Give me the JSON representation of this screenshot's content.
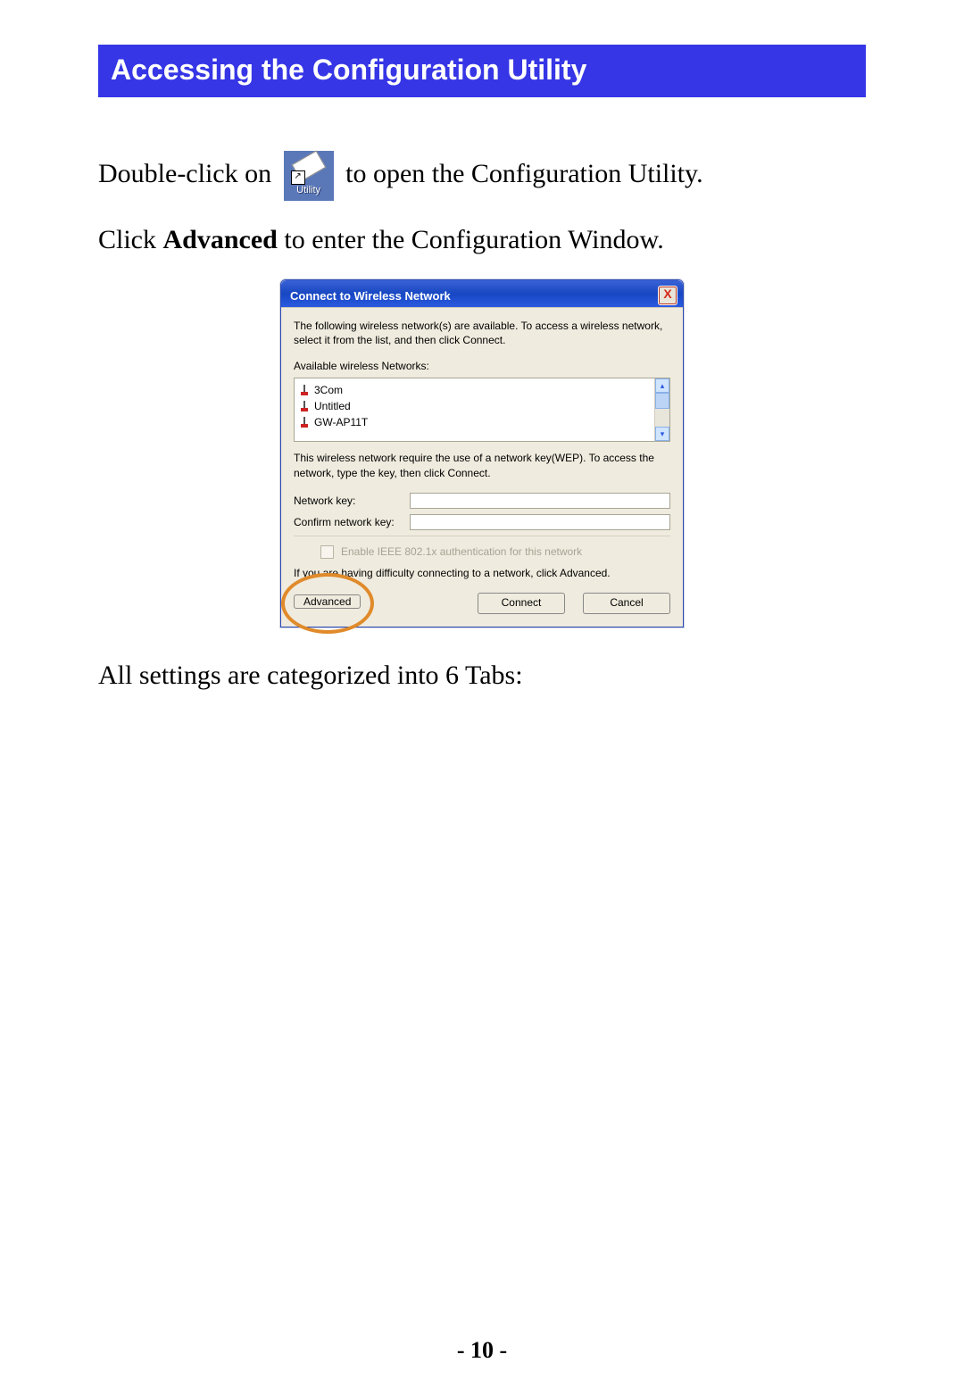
{
  "section_title": "Accessing the Configuration Utility",
  "para1_a": "Double-click on ",
  "para1_b": "to open the Configuration Utility.",
  "utility_icon_label": "Utility",
  "para2_a": "Click ",
  "para2_bold": "Advanced",
  "para2_b": " to enter the Configuration Window.",
  "dialog": {
    "title": "Connect to Wireless Network",
    "close": "X",
    "intro": "The following wireless network(s) are available. To access a wireless network, select it from the list, and then click Connect.",
    "available_label": "Available wireless Networks:",
    "networks": [
      "3Com",
      "Untitled",
      "GW-AP11T"
    ],
    "wep_text": "This wireless network require the use of a network key(WEP). To access the network, type the key, then click Connect.",
    "netkey_label": "Network key:",
    "confirm_label": "Confirm network key:",
    "ieee_label": "Enable IEEE 802.1x authentication for this network",
    "difficulty_text": "If you are having difficulty connecting to a network, click Advanced.",
    "btn_advanced": "Advanced",
    "btn_connect": "Connect",
    "btn_cancel": "Cancel"
  },
  "para3": "All settings are categorized into 6 Tabs:",
  "page_number": "- 10 -"
}
